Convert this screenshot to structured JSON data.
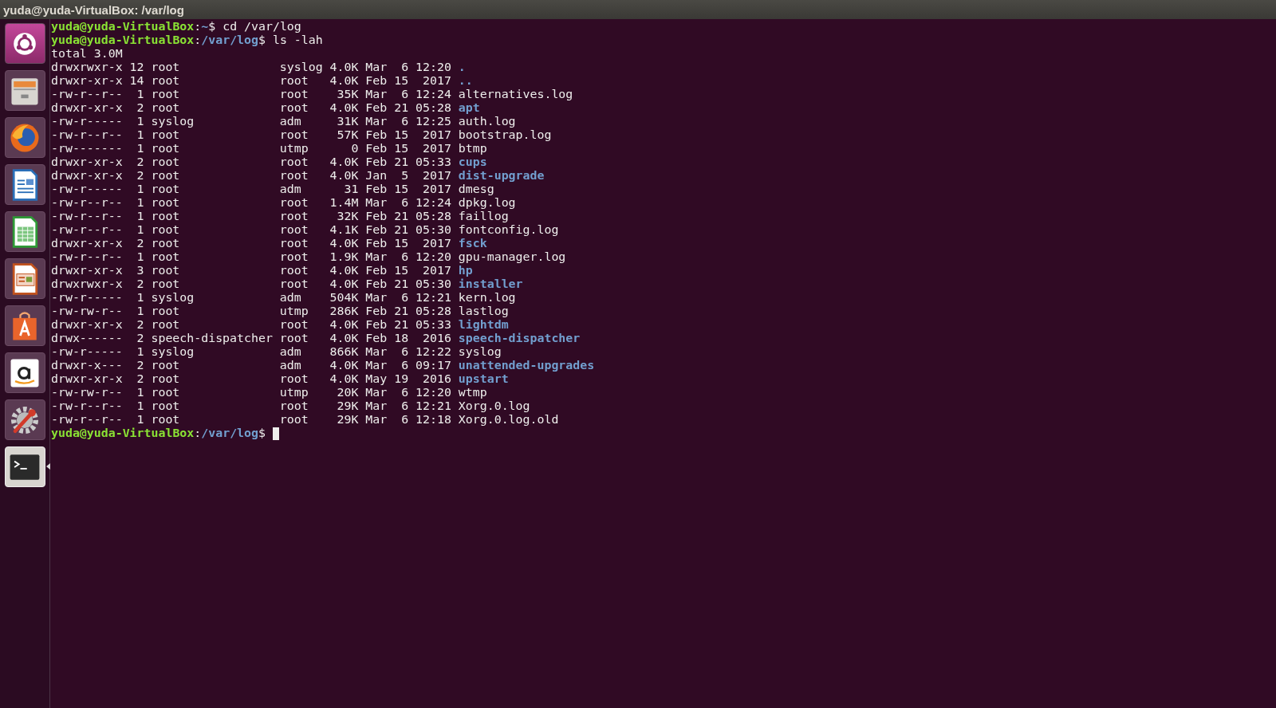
{
  "window": {
    "title": "yuda@yuda-VirtualBox: /var/log"
  },
  "launcher": [
    {
      "kind": "ubuntu",
      "active": false
    },
    {
      "kind": "files",
      "active": false
    },
    {
      "kind": "firefox",
      "active": false
    },
    {
      "kind": "writer",
      "active": false
    },
    {
      "kind": "calc",
      "active": false
    },
    {
      "kind": "impress",
      "active": false
    },
    {
      "kind": "store",
      "active": false
    },
    {
      "kind": "amazon",
      "active": false
    },
    {
      "kind": "settings",
      "active": false
    },
    {
      "kind": "terminal",
      "active": true
    }
  ],
  "terminal": {
    "lines": [
      {
        "kind": "prompt",
        "user_host": "yuda@yuda-VirtualBox",
        "separator": ":",
        "path": "~",
        "command": "$ cd /var/log"
      },
      {
        "kind": "prompt",
        "user_host": "yuda@yuda-VirtualBox",
        "separator": ":",
        "path": "/var/log",
        "command": "$ ls -lah"
      },
      {
        "kind": "text",
        "text": "total 3.0M"
      },
      {
        "kind": "dir_entry",
        "fields": [
          "drwxrwxr-x",
          "12",
          "root",
          "syslog",
          "4.0K",
          "Mar",
          "6",
          "12:20"
        ],
        "name": "."
      },
      {
        "kind": "dir_entry",
        "fields": [
          "drwxr-xr-x",
          "14",
          "root",
          "root",
          "4.0K",
          "Feb",
          "15",
          "2017"
        ],
        "name": ".."
      },
      {
        "kind": "file_entry",
        "fields": [
          "-rw-r--r--",
          "1",
          "root",
          "root",
          "35K",
          "Mar",
          "6",
          "12:24"
        ],
        "name": "alternatives.log"
      },
      {
        "kind": "dir_entry",
        "fields": [
          "drwxr-xr-x",
          "2",
          "root",
          "root",
          "4.0K",
          "Feb",
          "21",
          "05:28"
        ],
        "name": "apt"
      },
      {
        "kind": "file_entry",
        "fields": [
          "-rw-r-----",
          "1",
          "syslog",
          "adm",
          "31K",
          "Mar",
          "6",
          "12:25"
        ],
        "name": "auth.log"
      },
      {
        "kind": "file_entry",
        "fields": [
          "-rw-r--r--",
          "1",
          "root",
          "root",
          "57K",
          "Feb",
          "15",
          "2017"
        ],
        "name": "bootstrap.log"
      },
      {
        "kind": "file_entry",
        "fields": [
          "-rw-------",
          "1",
          "root",
          "utmp",
          "0",
          "Feb",
          "15",
          "2017"
        ],
        "name": "btmp"
      },
      {
        "kind": "dir_entry",
        "fields": [
          "drwxr-xr-x",
          "2",
          "root",
          "root",
          "4.0K",
          "Feb",
          "21",
          "05:33"
        ],
        "name": "cups"
      },
      {
        "kind": "dir_entry",
        "fields": [
          "drwxr-xr-x",
          "2",
          "root",
          "root",
          "4.0K",
          "Jan",
          "5",
          "2017"
        ],
        "name": "dist-upgrade"
      },
      {
        "kind": "file_entry",
        "fields": [
          "-rw-r-----",
          "1",
          "root",
          "adm",
          "31",
          "Feb",
          "15",
          "2017"
        ],
        "name": "dmesg"
      },
      {
        "kind": "file_entry",
        "fields": [
          "-rw-r--r--",
          "1",
          "root",
          "root",
          "1.4M",
          "Mar",
          "6",
          "12:24"
        ],
        "name": "dpkg.log"
      },
      {
        "kind": "file_entry",
        "fields": [
          "-rw-r--r--",
          "1",
          "root",
          "root",
          "32K",
          "Feb",
          "21",
          "05:28"
        ],
        "name": "faillog"
      },
      {
        "kind": "file_entry",
        "fields": [
          "-rw-r--r--",
          "1",
          "root",
          "root",
          "4.1K",
          "Feb",
          "21",
          "05:30"
        ],
        "name": "fontconfig.log"
      },
      {
        "kind": "dir_entry",
        "fields": [
          "drwxr-xr-x",
          "2",
          "root",
          "root",
          "4.0K",
          "Feb",
          "15",
          "2017"
        ],
        "name": "fsck"
      },
      {
        "kind": "file_entry",
        "fields": [
          "-rw-r--r--",
          "1",
          "root",
          "root",
          "1.9K",
          "Mar",
          "6",
          "12:20"
        ],
        "name": "gpu-manager.log"
      },
      {
        "kind": "dir_entry",
        "fields": [
          "drwxr-xr-x",
          "3",
          "root",
          "root",
          "4.0K",
          "Feb",
          "15",
          "2017"
        ],
        "name": "hp"
      },
      {
        "kind": "dir_entry",
        "fields": [
          "drwxrwxr-x",
          "2",
          "root",
          "root",
          "4.0K",
          "Feb",
          "21",
          "05:30"
        ],
        "name": "installer"
      },
      {
        "kind": "file_entry",
        "fields": [
          "-rw-r-----",
          "1",
          "syslog",
          "adm",
          "504K",
          "Mar",
          "6",
          "12:21"
        ],
        "name": "kern.log"
      },
      {
        "kind": "file_entry",
        "fields": [
          "-rw-rw-r--",
          "1",
          "root",
          "utmp",
          "286K",
          "Feb",
          "21",
          "05:28"
        ],
        "name": "lastlog"
      },
      {
        "kind": "dir_entry",
        "fields": [
          "drwxr-xr-x",
          "2",
          "root",
          "root",
          "4.0K",
          "Feb",
          "21",
          "05:33"
        ],
        "name": "lightdm"
      },
      {
        "kind": "dir_entry",
        "fields": [
          "drwx------",
          "2",
          "speech-dispatcher",
          "root",
          "4.0K",
          "Feb",
          "18",
          "2016"
        ],
        "name": "speech-dispatcher"
      },
      {
        "kind": "file_entry",
        "fields": [
          "-rw-r-----",
          "1",
          "syslog",
          "adm",
          "866K",
          "Mar",
          "6",
          "12:22"
        ],
        "name": "syslog"
      },
      {
        "kind": "dir_entry",
        "fields": [
          "drwxr-x---",
          "2",
          "root",
          "adm",
          "4.0K",
          "Mar",
          "6",
          "09:17"
        ],
        "name": "unattended-upgrades"
      },
      {
        "kind": "dir_entry",
        "fields": [
          "drwxr-xr-x",
          "2",
          "root",
          "root",
          "4.0K",
          "May",
          "19",
          "2016"
        ],
        "name": "upstart"
      },
      {
        "kind": "file_entry",
        "fields": [
          "-rw-rw-r--",
          "1",
          "root",
          "utmp",
          "20K",
          "Mar",
          "6",
          "12:20"
        ],
        "name": "wtmp"
      },
      {
        "kind": "file_entry",
        "fields": [
          "-rw-r--r--",
          "1",
          "root",
          "root",
          "29K",
          "Mar",
          "6",
          "12:21"
        ],
        "name": "Xorg.0.log"
      },
      {
        "kind": "file_entry",
        "fields": [
          "-rw-r--r--",
          "1",
          "root",
          "root",
          "29K",
          "Mar",
          "6",
          "12:18"
        ],
        "name": "Xorg.0.log.old"
      },
      {
        "kind": "prompt",
        "user_host": "yuda@yuda-VirtualBox",
        "separator": ":",
        "path": "/var/log",
        "command": "$",
        "cursor": true
      }
    ]
  }
}
